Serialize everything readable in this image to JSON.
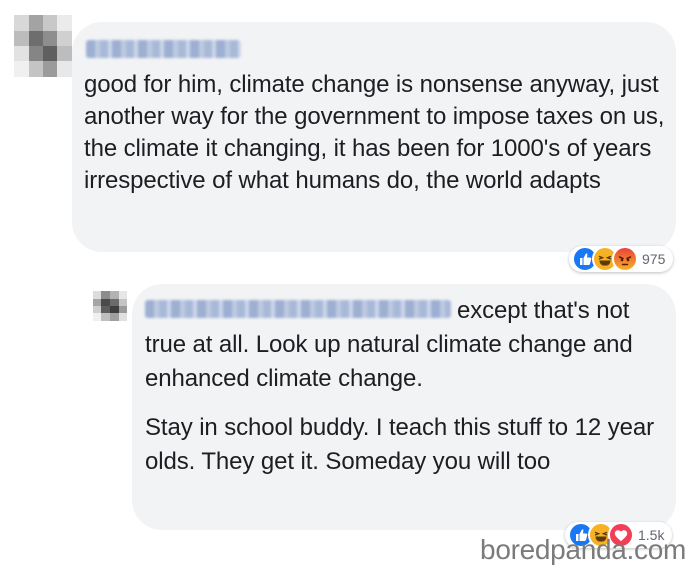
{
  "comment": {
    "text": "good for him, climate change is nonsense anyway, just another way for the government to impose taxes on us, the climate it changing, it has been for 1000's of years irrespective of what humans do, the world adapts",
    "reactions": {
      "icons": [
        "like-icon",
        "haha-icon",
        "angry-icon"
      ],
      "count": "975"
    }
  },
  "reply": {
    "text_lead": "except that's not true at all. Look up natural climate change and enhanced climate change.",
    "text_second": "Stay in school buddy. I teach this stuff to 12 year olds. They get it. Someday you will too",
    "reactions": {
      "icons": [
        "like-icon",
        "haha-icon",
        "love-icon"
      ],
      "count": "1.5k"
    }
  },
  "watermark": "boredpanda.com",
  "colors": {
    "bubble": "#f2f3f5",
    "text": "#1c1e21",
    "like": "#1877f2",
    "haha": "#f7b125",
    "angry": "#e9710f",
    "love": "#f33e58",
    "count": "#616770",
    "watermark": "#7b7b7b"
  }
}
